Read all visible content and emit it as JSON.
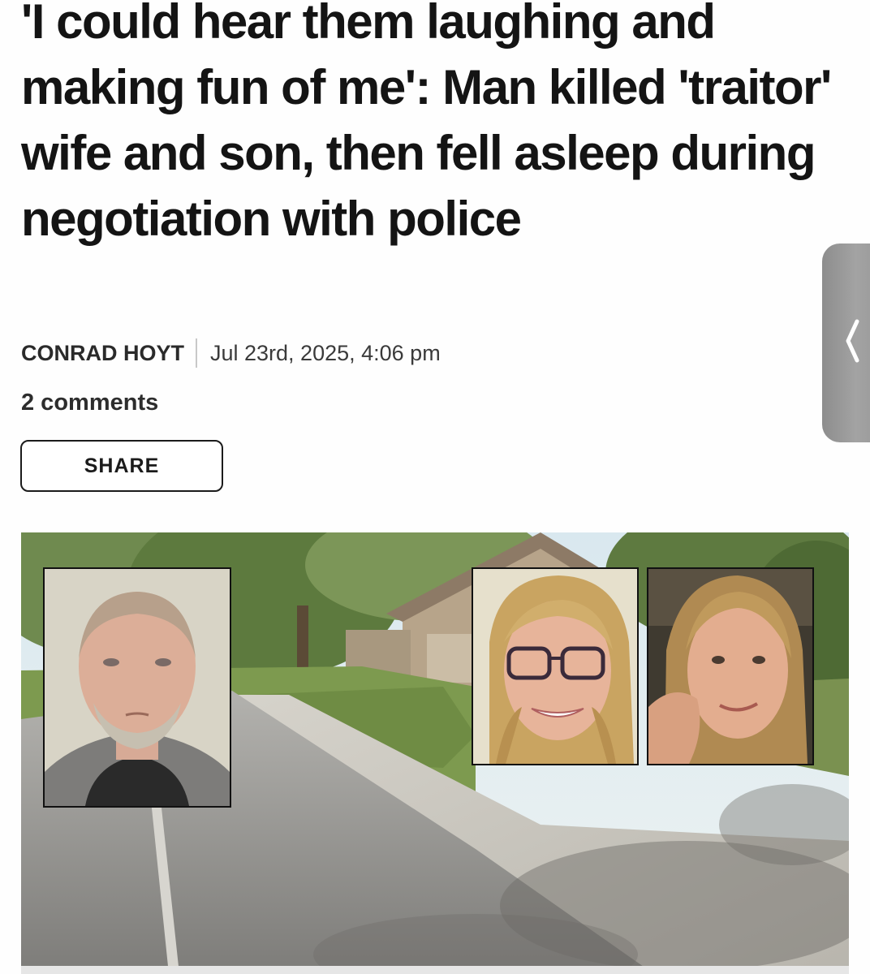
{
  "article": {
    "headline": "'I could hear them laughing and making fun of me': Man killed 'traitor' wife and son, then fell asleep during negotiation with police",
    "author": "CONRAD HOYT",
    "date": "Jul 23rd, 2025, 4:06 pm",
    "comments": "2 comments",
    "share_label": "SHARE"
  },
  "hero": {
    "scene": "suburban street with houses and trees",
    "insets": [
      "mugshot of man",
      "portrait of woman with glasses",
      "portrait of young man"
    ]
  },
  "icons": {
    "side_handle": "chevron-left-icon"
  },
  "colors": {
    "headline": "#141414",
    "button_border": "#1b1b1b",
    "handle": "#9a9a9a"
  }
}
